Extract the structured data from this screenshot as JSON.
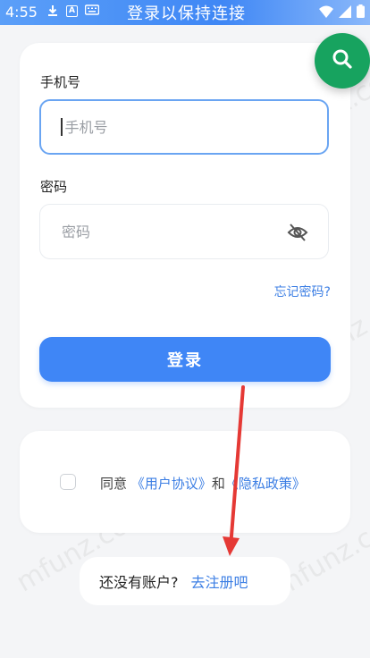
{
  "status_bar": {
    "time": "4:55",
    "title": "登录以保持连接",
    "left_icons": [
      "download-icon",
      "a-box-icon",
      "keyboard-icon"
    ],
    "right_icons": [
      "wifi-icon",
      "signal-icon",
      "battery-icon"
    ]
  },
  "login": {
    "phone_label": "手机号",
    "phone_placeholder": "手机号",
    "password_label": "密码",
    "password_placeholder": "密码",
    "forgot_password": "忘记密码?",
    "login_button": "登录"
  },
  "agreement": {
    "prefix": "同意",
    "user_agreement": "《用户协议》",
    "and": "和",
    "privacy_policy": "《隐私政策》",
    "checked": false
  },
  "register": {
    "prompt": "还没有账户?",
    "link": "去注册吧"
  },
  "watermark": "mfunz.com",
  "colors": {
    "accent": "#3f86f6",
    "link": "#3d7fe4",
    "fab": "#17a35f",
    "annotation_arrow": "#e53935"
  }
}
